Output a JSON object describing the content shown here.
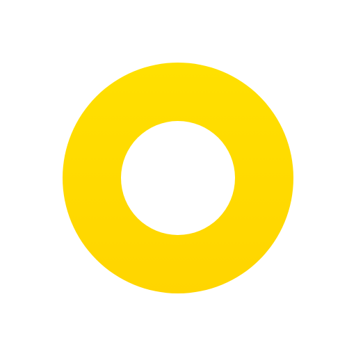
{
  "logo": {
    "icon": "yellow-ring-icon",
    "colors": {
      "ring_top": "#FFE000",
      "ring_bottom": "#FFD500",
      "background": "#FFFFFF"
    }
  }
}
